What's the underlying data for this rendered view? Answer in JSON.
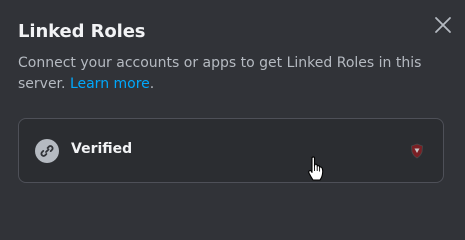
{
  "modal": {
    "title": "Linked Roles",
    "description": "Connect your accounts or apps to get Linked Roles in this server.",
    "learn_more": "Learn more",
    "trailing_period": ".",
    "close_icon": "close-icon"
  },
  "roles": [
    {
      "name": "Verified",
      "icon": "link-icon",
      "app_icon": "shield-badge-icon"
    }
  ],
  "colors": {
    "background": "#313338",
    "link": "#00a8fc",
    "card_border": "#4e5058"
  }
}
